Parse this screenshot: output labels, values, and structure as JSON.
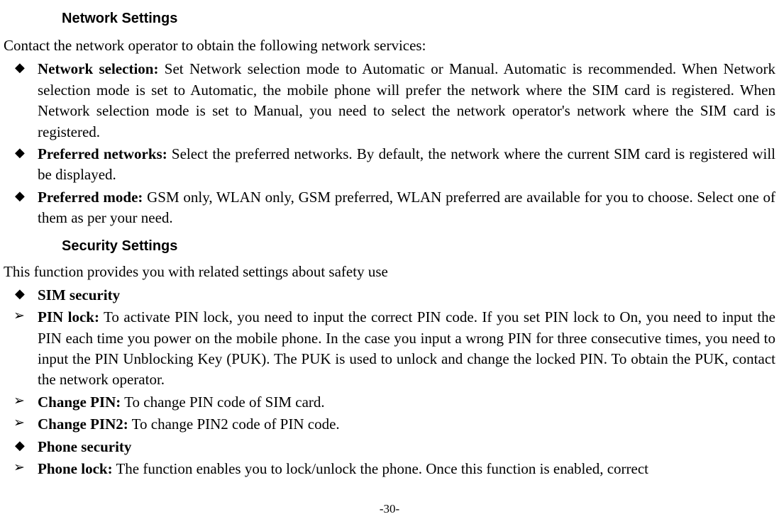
{
  "headings": {
    "network": "Network Settings",
    "security": "Security Settings"
  },
  "network": {
    "intro": "Contact the network operator to obtain the following network services:",
    "items": [
      {
        "label": "Network selection:",
        "text": " Set Network selection mode to Automatic or Manual. Automatic is recommended. When Network selection mode is set to Automatic, the mobile phone will prefer the network where the SIM card is registered. When Network selection mode is set to Manual, you need to select the network operator's network where the SIM card is registered."
      },
      {
        "label": "Preferred networks:",
        "text": " Select the preferred networks. By default, the network where the current SIM card is registered will be displayed."
      },
      {
        "label": "Preferred mode:",
        "text": " GSM only, WLAN only, GSM preferred, WLAN preferred are available for you to choose. Select one of them as per your need."
      }
    ]
  },
  "security": {
    "intro": "This function provides you with related settings about safety use",
    "items": [
      {
        "type": "diamond",
        "label": "SIM security",
        "text": ""
      },
      {
        "type": "chevron",
        "label": "PIN lock:",
        "text": " To activate PIN lock, you need to input the correct PIN code. If you set PIN lock to On, you need to input the PIN each time you power on the mobile phone. In the case you input a wrong PIN for three consecutive times, you need to input the PIN Unblocking Key (PUK). The PUK is used to unlock and change the locked PIN. To obtain the PUK, contact the network operator."
      },
      {
        "type": "chevron",
        "label": "Change PIN:",
        "text": " To change PIN code of SIM card."
      },
      {
        "type": "chevron",
        "label": "Change PIN2:",
        "text": " To change PIN2 code of PIN code."
      },
      {
        "type": "diamond",
        "label": "Phone security",
        "text": ""
      },
      {
        "type": "chevron",
        "label": "Phone lock:",
        "text": " The function enables you to lock/unlock the phone. Once this function is enabled, correct"
      }
    ]
  },
  "page_number": "-30-"
}
